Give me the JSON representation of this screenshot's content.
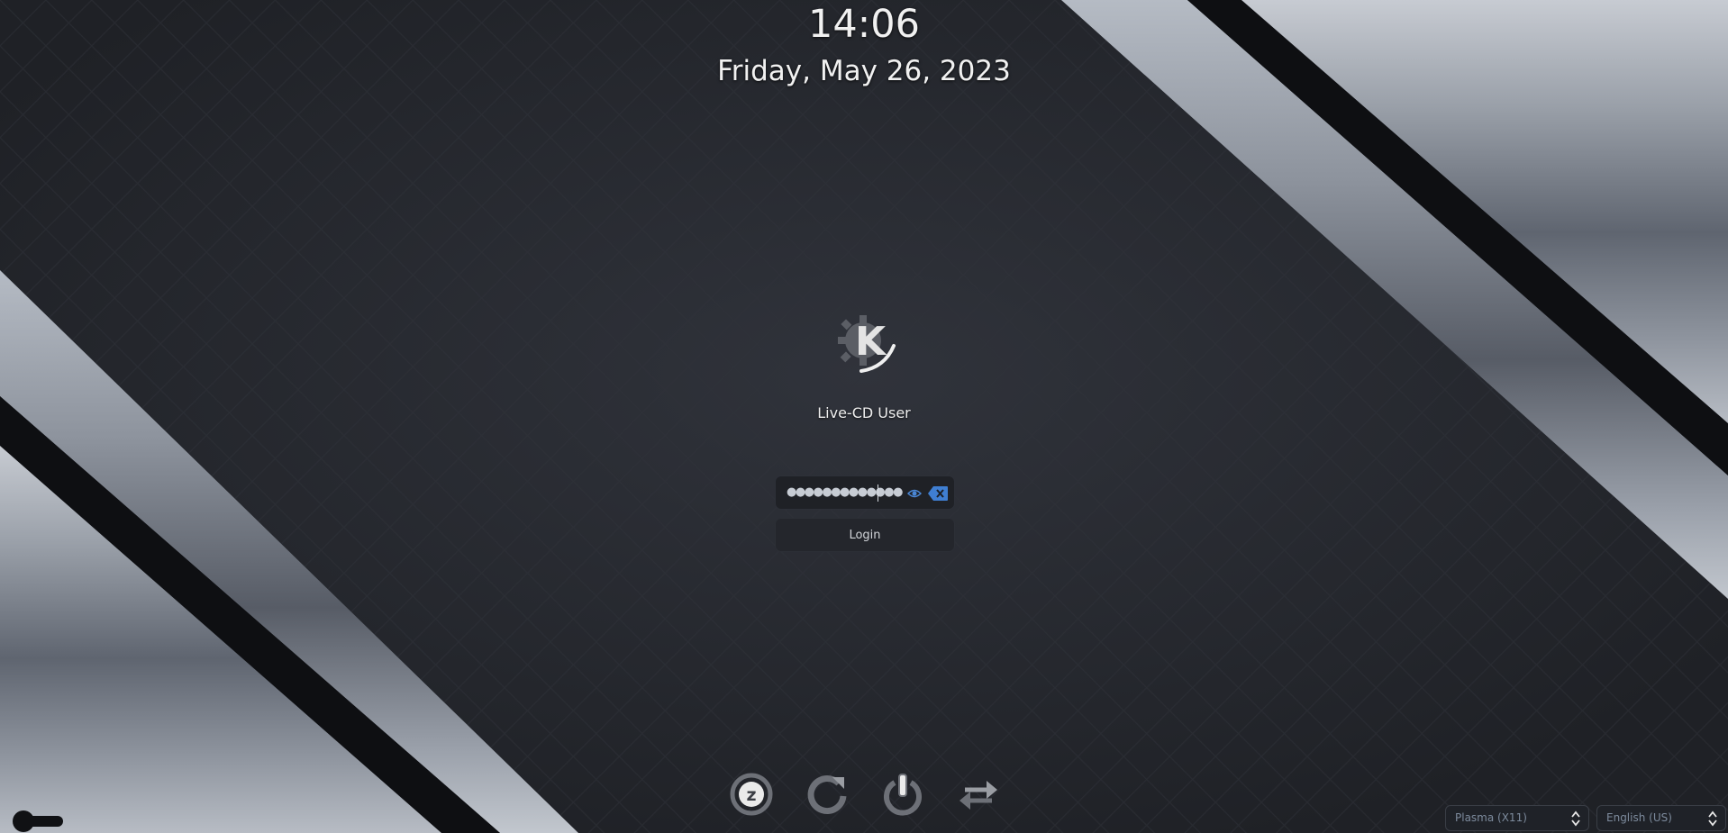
{
  "clock": {
    "time": "14:06",
    "date": "Friday, May 26, 2023"
  },
  "user": {
    "name": "Live-CD User",
    "avatar_icon": "kde-logo-icon"
  },
  "password": {
    "masked_value": "●●●●●●●●●●●●●"
  },
  "login": {
    "label": "Login"
  },
  "actions": [
    {
      "icon": "suspend-icon"
    },
    {
      "icon": "restart-icon"
    },
    {
      "icon": "shutdown-icon"
    },
    {
      "icon": "switch-user-icon"
    }
  ],
  "footer": {
    "session": "Plasma (X11)",
    "language": "English (US)"
  },
  "colors": {
    "accent": "#3f7ed1",
    "background": "#25282f",
    "stripe": "#8d939d"
  }
}
